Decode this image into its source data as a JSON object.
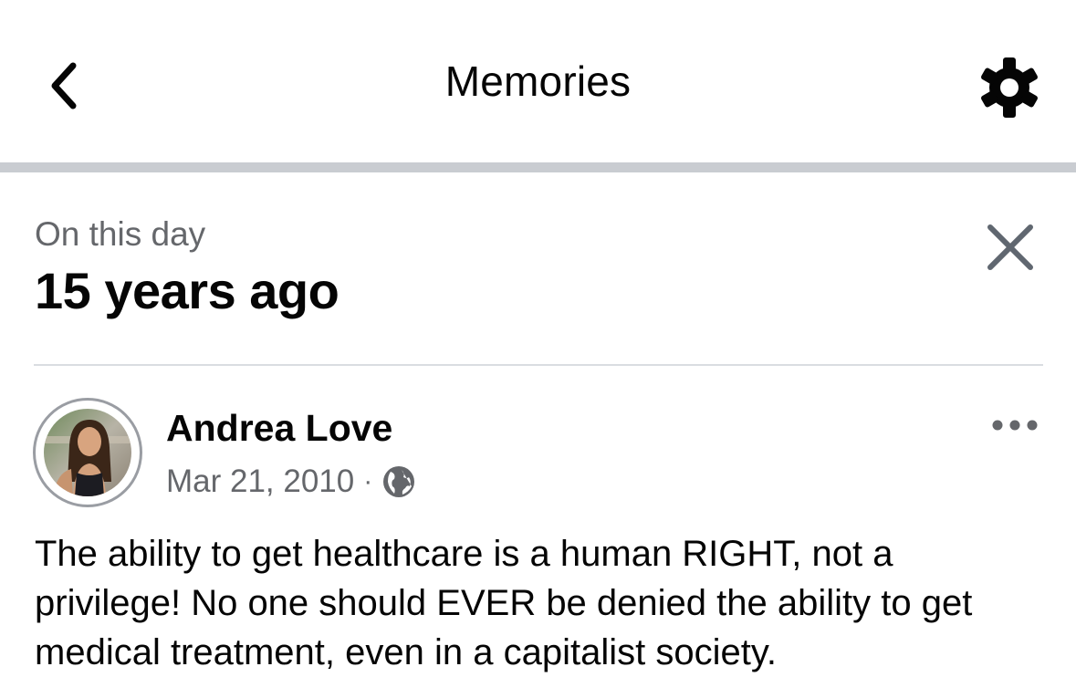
{
  "header": {
    "title": "Memories",
    "back_icon": "chevron-left-icon",
    "settings_icon": "gear-icon"
  },
  "memory": {
    "subtitle": "On this day",
    "years_ago": "15 years ago",
    "close_icon": "close-icon"
  },
  "post": {
    "author": "Andrea Love",
    "date": "Mar 21, 2010",
    "separator": "·",
    "audience_icon": "globe-icon",
    "more_icon": "more-horizontal-icon",
    "text": "The ability to get healthcare is a human RIGHT, not a privilege! No one should EVER be denied the ability to get medical treatment, even in a capitalist society."
  },
  "colors": {
    "primary_text": "#050505",
    "secondary_text": "#65676b",
    "divider_thick": "#c9ccd1",
    "divider_thin": "#dadde1"
  }
}
